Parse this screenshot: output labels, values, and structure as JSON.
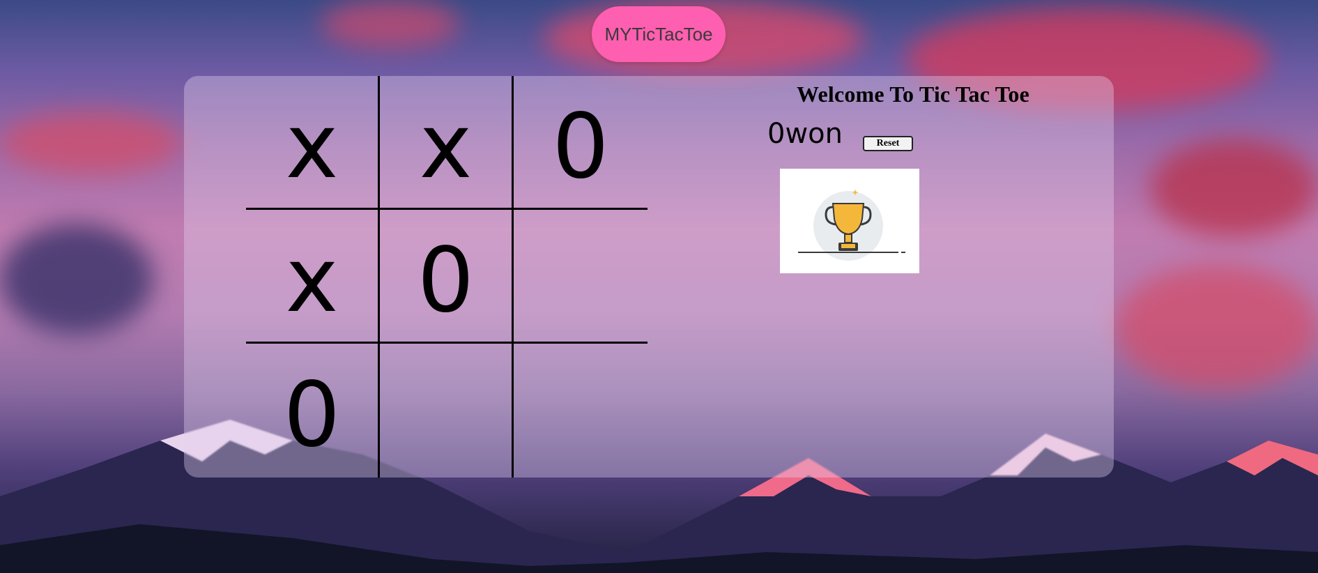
{
  "nav": {
    "brand": "MYTicTacToe"
  },
  "game": {
    "title": "Welcome To Tic Tac Toe",
    "status": "0won",
    "reset_label": "Reset",
    "board": [
      [
        "x",
        "x",
        "0"
      ],
      [
        "x",
        "0",
        ""
      ],
      [
        "0",
        "",
        ""
      ]
    ]
  },
  "image": {
    "icon": "trophy-icon"
  },
  "colors": {
    "brand_pill": "#ff5fb0",
    "trophy_gold": "#f4b73a",
    "trophy_bg": "#e8ecef"
  }
}
